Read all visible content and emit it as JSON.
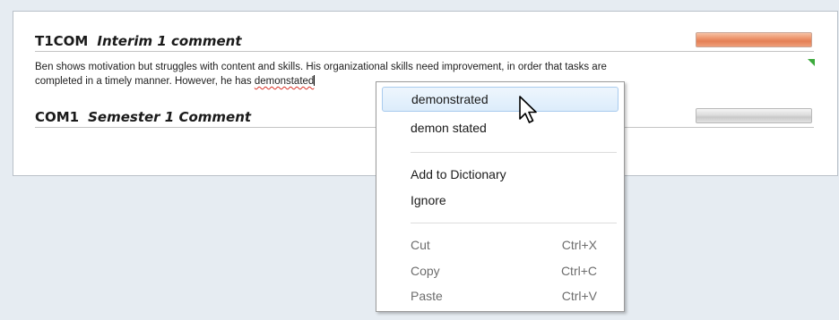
{
  "sections": [
    {
      "code": "T1COM",
      "title": "Interim 1 comment",
      "bar_color": "#e8895e"
    },
    {
      "code": "COM1",
      "title": "Semester 1 Comment",
      "bar_color": "#d0d0d0"
    }
  ],
  "comment": {
    "line1": "Ben shows motivation but struggles with content and skills. His organizational skills need improvement, in order that tasks are",
    "line2_prefix": "completed in a timely manner. However, he has ",
    "misspelled_word": "demonstated"
  },
  "context_menu": {
    "suggestions": [
      "demonstrated",
      "demon stated"
    ],
    "add_to_dictionary": "Add to Dictionary",
    "ignore": "Ignore",
    "edit_actions": [
      {
        "label": "Cut",
        "shortcut": "Ctrl+X"
      },
      {
        "label": "Copy",
        "shortcut": "Ctrl+C"
      },
      {
        "label": "Paste",
        "shortcut": "Ctrl+V"
      }
    ]
  },
  "icons": {
    "cursor": "mouse-pointer-arrow-icon",
    "resize": "resize-corner-icon"
  },
  "colors": {
    "background": "#e6ecf2",
    "highlight_border": "#a9cbee",
    "spell_underline": "#d93025"
  }
}
